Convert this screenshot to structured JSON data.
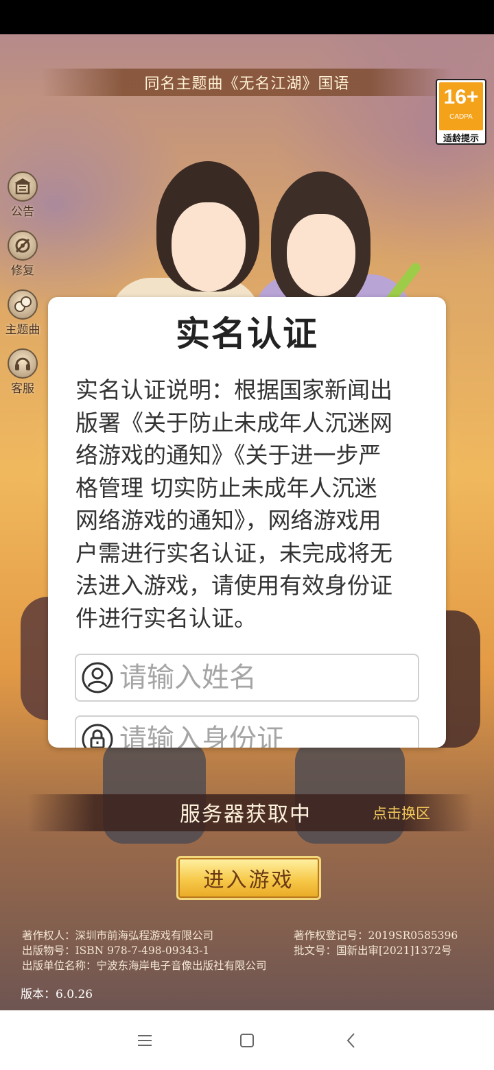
{
  "theme_banner": "同名主题曲《无名江湖》国语",
  "age_rating": {
    "value": "16+",
    "org": "CADPA",
    "tip": "适龄提示",
    "color": "#f4a21a"
  },
  "side_menu": [
    {
      "label": "公告",
      "icon": "announcement-icon"
    },
    {
      "label": "修复",
      "icon": "repair-icon"
    },
    {
      "label": "主题曲",
      "icon": "theme-song-icon"
    },
    {
      "label": "客服",
      "icon": "customer-service-icon"
    }
  ],
  "dialog": {
    "title": "实名认证",
    "description_lines": [
      "实名认证说明：根据国家新闻出",
      "版署《关于防止未成年人沉迷网",
      "络游戏的通知》《关于进一步严",
      "格管理 切实防止未成年人沉迷",
      "网络游戏的通知》，网络游戏用",
      "户需进行实名认证，未完成将无",
      "法进入游戏，请使用有效身份证",
      "件进行实名认证。"
    ],
    "name_placeholder": "请输入姓名",
    "id_placeholder": "请输入身份证"
  },
  "server": {
    "status": "服务器获取中",
    "switch_label": "点击换区"
  },
  "enter_button": "进入游戏",
  "legal": {
    "copyright_holder": "著作权人：深圳市前海弘程游戏有限公司",
    "registration_no": "著作权登记号：2019SR0585396",
    "publication_no": "出版物号：ISBN 978-7-498-09343-1",
    "approval_no": "批文号：国新出审[2021]1372号",
    "publisher": "出版单位名称：宁波东海岸电子音像出版社有限公司"
  },
  "version": "版本：6.0.26"
}
